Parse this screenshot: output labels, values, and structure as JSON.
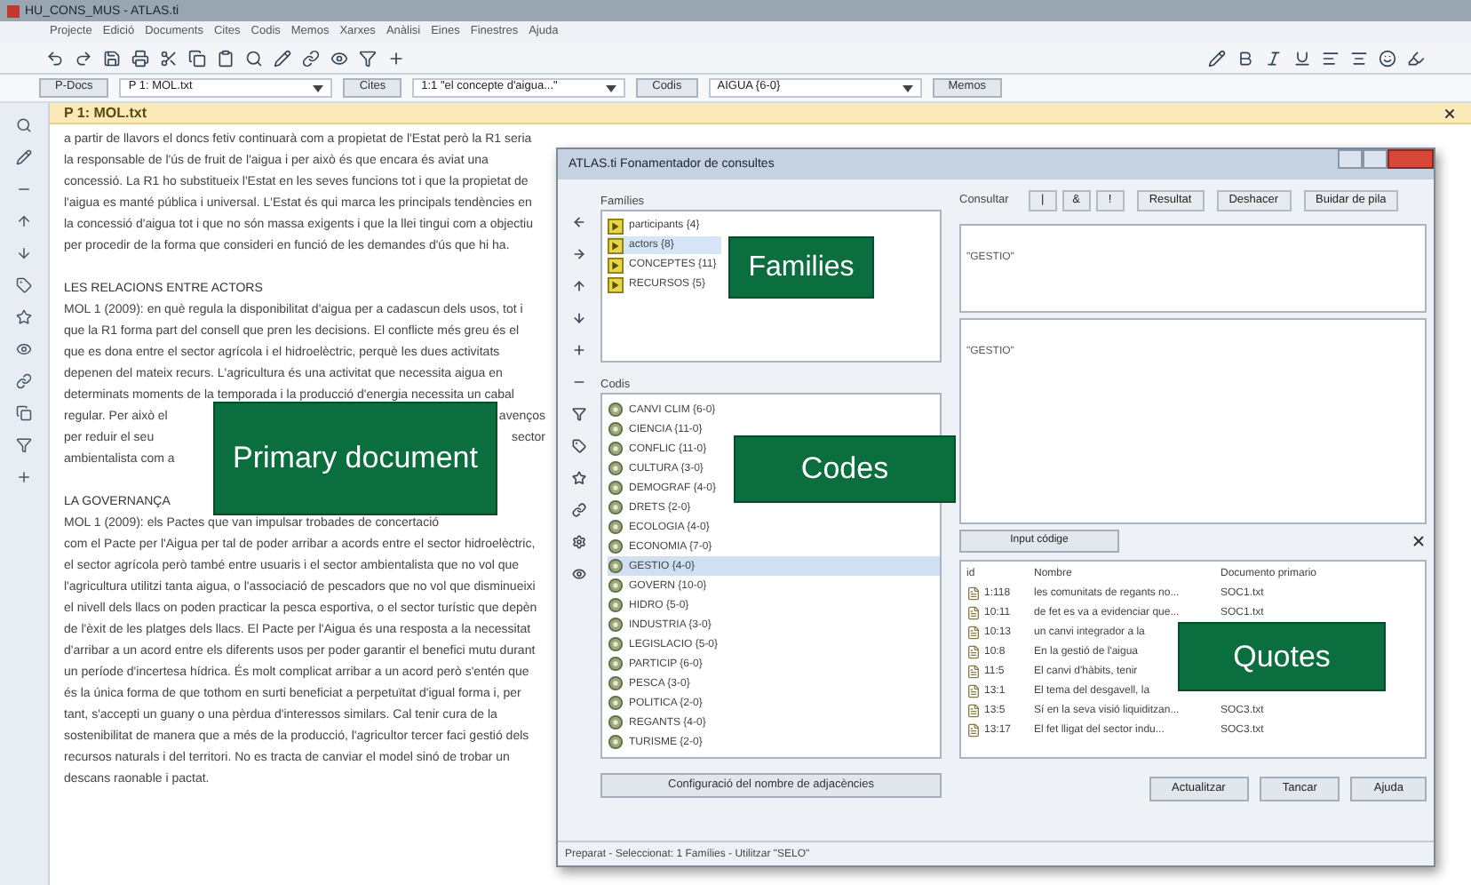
{
  "window": {
    "title": "HU_CONS_MUS - ATLAS.ti"
  },
  "menu": [
    "Projecte",
    "Edició",
    "Documents",
    "Cites",
    "Codis",
    "Memos",
    "Xarxes",
    "Anàlisi",
    "Eines",
    "Finestres",
    "Ajuda"
  ],
  "selector_bar": [
    {
      "kind": "button",
      "label": "P-Docs"
    },
    {
      "kind": "dropdown",
      "value": "P 1: MOL.txt"
    },
    {
      "kind": "button",
      "label": "Cites"
    },
    {
      "kind": "dropdown",
      "value": "1:1 \"el concepte d'aigua...\""
    },
    {
      "kind": "button",
      "label": "Codis"
    },
    {
      "kind": "dropdown",
      "value": "AIGUA {6-0}"
    },
    {
      "kind": "button",
      "label": "Memos"
    }
  ],
  "document": {
    "title": "P 1: MOL.txt",
    "paragraphs": [
      {
        "kind": "text",
        "text": "a partir de llavors el doncs fetiv continuarà com a propietat de l'Estat però la R1 seria la responsable de l'ús de fruit de l'aigua i per això és que encara és aviat una concessió. La R1 ho substitueix l'Estat en les seves funcions tot i que la propietat de l'aigua es manté pública i universal. L'Estat és qui marca les principals tendències en la concessió d'aigua tot i que no són massa exigents i que la llei tingui com a objectiu per procedir de la forma que consideri en funció de les demandes d'ús que hi ha."
      },
      {
        "kind": "heading",
        "text": "LES RELACIONS ENTRE ACTORS"
      },
      {
        "kind": "line",
        "text": "MOL 1 (2009): en què regula la disponibilitat d'aigua per a cadascun dels usos, tot i"
      },
      {
        "kind": "line",
        "text": "que la R1 forma part del consell que pren les decisions. El conflicte més greu és el"
      },
      {
        "kind": "line",
        "text": "que es dona entre el sector agrícola i el hidroelèctric, perquè les dues activitats"
      },
      {
        "kind": "line",
        "text": "depenen del mateix recurs. L'agricultura és una activitat que necessita aigua en"
      },
      {
        "kind": "line",
        "text": "determinats moments de la temporada i la producció d'energia necessita un cabal"
      },
      {
        "kind": "split",
        "left": "regular. Per això el",
        "right": "avenços"
      },
      {
        "kind": "split",
        "left": "per reduir el seu",
        "right": "sector"
      },
      {
        "kind": "split",
        "left": "ambientalista com a"
      },
      {
        "kind": "heading",
        "text": "LA GOVERNANÇA"
      },
      {
        "kind": "text",
        "text": "MOL 1 (2009): els Pactes que van impulsar trobades de concertació"
      },
      {
        "kind": "text",
        "text": "com el Pacte per l'Aigua per tal de poder arribar a acords entre el sector hidroelèctric, el sector agrícola però també entre usuaris i el sector ambientalista que no vol que l'agricultura utilitzi tanta aigua, o l'associació de pescadors que no vol que disminueixi el nivell dels llacs on poden practicar la pesca esportiva, o el sector turístic que depèn de l'èxit de les platges dels llacs. El Pacte per l'Aigua és una resposta a la necessitat d'arribar a un acord entre els diferents usos per poder garantir el benefici mutu durant un període d'incertesa hídrica. És molt complicat arribar a un acord però s'entén que és la única forma de que tothom en surti beneficiat a perpetuïtat d'igual forma i, per tant, s'accepti un guany o una pèrdua d'interessos similars. Cal tenir cura de la sostenibilitat de manera que a més de la producció, l'agricultor tercer faci gestió dels recursos naturals i del territori. No es tracta de canviar el model sinó de trobar un descans raonable i pactat."
      }
    ]
  },
  "dialog": {
    "title": "ATLAS.ti Fonamentador de consultes",
    "families_label": "Famílies",
    "families": [
      {
        "name": "participants {4}",
        "selected": false
      },
      {
        "name": "actors {8}",
        "selected": true
      },
      {
        "name": "CONCEPTES {11}",
        "selected": false
      },
      {
        "name": "RECURSOS {5}",
        "selected": false
      }
    ],
    "codes_label": "Codis",
    "codes": [
      {
        "name": "CANVI CLIM {6-0}",
        "selected": false
      },
      {
        "name": "CIENCIA {11-0}",
        "selected": false
      },
      {
        "name": "CONFLIC {11-0}",
        "selected": false
      },
      {
        "name": "CULTURA {3-0}",
        "selected": false
      },
      {
        "name": "DEMOGRAF {4-0}",
        "selected": false
      },
      {
        "name": "DRETS {2-0}",
        "selected": false
      },
      {
        "name": "ECOLOGIA {4-0}",
        "selected": false
      },
      {
        "name": "ECONOMIA {7-0}",
        "selected": false
      },
      {
        "name": "GESTIO {4-0}",
        "selected": true
      },
      {
        "name": "GOVERN {10-0}",
        "selected": false
      },
      {
        "name": "HIDRO {5-0}",
        "selected": false
      },
      {
        "name": "INDUSTRIA {3-0}",
        "selected": false
      },
      {
        "name": "LEGISLACIO {5-0}",
        "selected": false
      },
      {
        "name": "PARTICIP {6-0}",
        "selected": false
      },
      {
        "name": "PESCA {3-0}",
        "selected": false
      },
      {
        "name": "POLITICA {2-0}",
        "selected": false
      },
      {
        "name": "REGANTS {4-0}",
        "selected": false
      },
      {
        "name": "TURISME {2-0}",
        "selected": false
      }
    ],
    "adjacency_button": "Configuració del nombre de adjacències",
    "query_label": "Consultar",
    "operators": [
      "|",
      "&",
      "!"
    ],
    "query_buttons": [
      "Resultat",
      "Deshacer",
      "Buidar de pila"
    ],
    "query_stack": "\"GESTIO\"",
    "query_term": "\"GESTIO\"",
    "export_button": "Input códige",
    "quote_columns": [
      "id",
      "Nombre",
      "Documento primario"
    ],
    "quotes": [
      {
        "id": "1:118",
        "name": "les comunitats de regants no...",
        "doc": "SOC1.txt"
      },
      {
        "id": "10:11",
        "name": "de fet es va a evidenciar que...",
        "doc": "SOC1.txt"
      },
      {
        "id": "10:13",
        "name": "un canvi integrador a la"
      },
      {
        "id": "10:8",
        "name": "En la gestió de l'aigua"
      },
      {
        "id": "11:5",
        "name": "El canvi d'hàbits, tenir"
      },
      {
        "id": "13:1",
        "name": "El tema del desgavell, la"
      },
      {
        "id": "13:5",
        "name": "Sí en la seva visió liquiditzan...",
        "doc": "SOC3.txt"
      },
      {
        "id": "13:17",
        "name": "El fet lligat del sector indu...",
        "doc": "SOC3.txt"
      }
    ],
    "footer_buttons": [
      "Actualitzar",
      "Tancar",
      "Ajuda"
    ],
    "status": "Preparat - Seleccionat: 1 Famílies - Utilitzar \"SELO\""
  },
  "annotations": [
    "Primary document",
    "Families",
    "Codes",
    "Quotes"
  ]
}
